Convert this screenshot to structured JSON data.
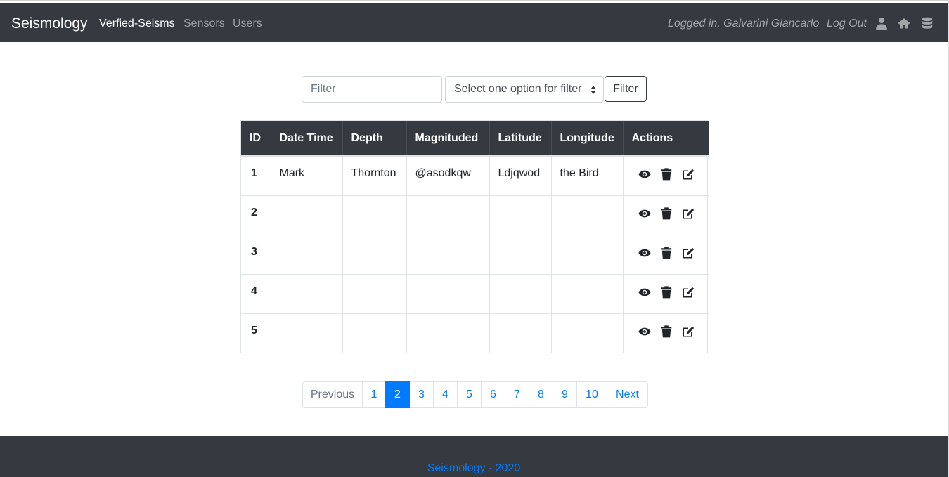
{
  "navbar": {
    "brand": "Seismology",
    "links": [
      {
        "label": "Verfied-Seisms",
        "active": true
      },
      {
        "label": "Sensors",
        "active": false
      },
      {
        "label": "Users",
        "active": false
      }
    ],
    "logged_in_text": "Logged in, Galvarini Giancarlo",
    "logout_label": "Log Out",
    "icons": [
      "user-icon",
      "home-icon",
      "database-icon"
    ]
  },
  "filter": {
    "input_placeholder": "Filter",
    "select_value": "Select one option for filter",
    "button_label": "Filter"
  },
  "table": {
    "columns": [
      "ID",
      "Date Time",
      "Depth",
      "Magnituded",
      "Latitude",
      "Longitude",
      "Actions"
    ],
    "rows": [
      {
        "id": "1",
        "date_time": "Mark",
        "depth": "Thornton",
        "magnitude": "@asodkqw",
        "latitude": "Ldjqwod",
        "longitude": "the Bird"
      },
      {
        "id": "2",
        "date_time": "",
        "depth": "",
        "magnitude": "",
        "latitude": "",
        "longitude": ""
      },
      {
        "id": "3",
        "date_time": "",
        "depth": "",
        "magnitude": "",
        "latitude": "",
        "longitude": ""
      },
      {
        "id": "4",
        "date_time": "",
        "depth": "",
        "magnitude": "",
        "latitude": "",
        "longitude": ""
      },
      {
        "id": "5",
        "date_time": "",
        "depth": "",
        "magnitude": "",
        "latitude": "",
        "longitude": ""
      }
    ],
    "row_action_icons": [
      "eye-icon",
      "trash-icon",
      "edit-icon"
    ]
  },
  "pagination": {
    "previous_label": "Previous",
    "pages": [
      "1",
      "2",
      "3",
      "4",
      "5",
      "6",
      "7",
      "8",
      "9",
      "10"
    ],
    "active_page": "2",
    "next_label": "Next"
  },
  "footer": {
    "text": "Seismology - 2020"
  },
  "colors": {
    "navbar_bg": "#343a40",
    "accent": "#007bff",
    "muted": "#6c757d"
  }
}
